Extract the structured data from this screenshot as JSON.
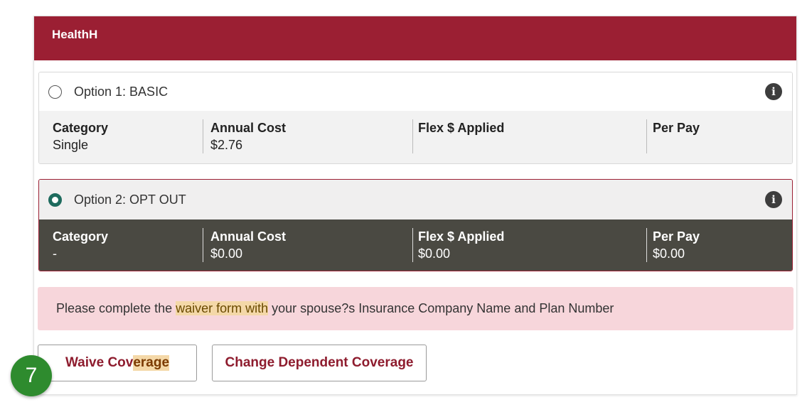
{
  "panel": {
    "title": "HealthH"
  },
  "options": [
    {
      "label": "Option 1: BASIC",
      "selected": false,
      "columns": [
        {
          "label": "Category",
          "value": "Single"
        },
        {
          "label": "Annual Cost",
          "value": "$2.76"
        },
        {
          "label": "Flex $ Applied",
          "value": ""
        },
        {
          "label": "Per Pay",
          "value": ""
        }
      ]
    },
    {
      "label": "Option 2: OPT OUT",
      "selected": true,
      "columns": [
        {
          "label": "Category",
          "value": "-"
        },
        {
          "label": "Annual Cost",
          "value": "$0.00"
        },
        {
          "label": "Flex $ Applied",
          "value": "$0.00"
        },
        {
          "label": "Per Pay",
          "value": "$0.00"
        }
      ]
    }
  ],
  "alert": {
    "part1": "Please complete the ",
    "highlight": "waiver form with",
    "part2": " your spouse?s Insurance Company Name and Plan Number"
  },
  "buttons": {
    "waive_part1": "Waive Cov",
    "waive_highlight": "erage",
    "change": "Change Dependent Coverage"
  },
  "step_badge": "7",
  "icons": {
    "info": "info-icon"
  },
  "colors": {
    "header": "#9b1f33",
    "selected_radio": "#1e6b5e",
    "dark_row": "#4a4942",
    "alert_bg": "#f7d6db",
    "badge": "#2e8b2e"
  }
}
